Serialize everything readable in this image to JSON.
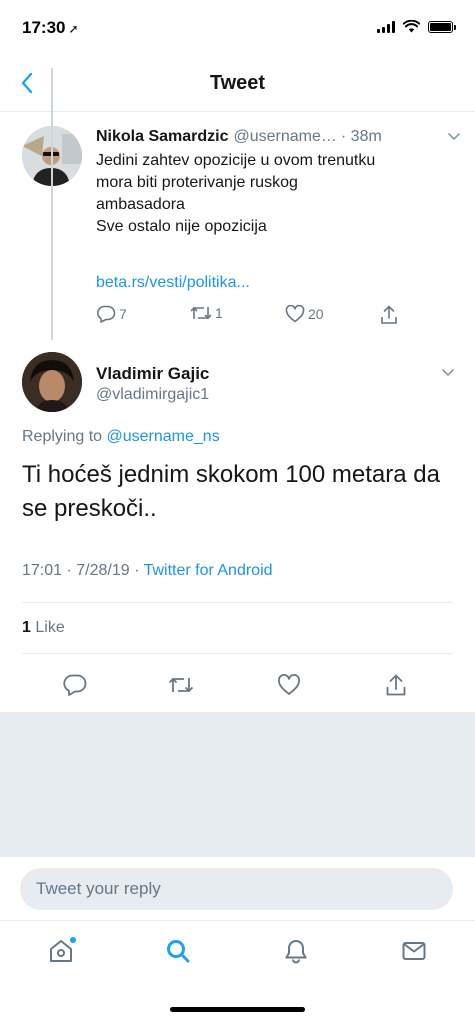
{
  "status_bar": {
    "time": "17:30",
    "location_arrow": "➚"
  },
  "header": {
    "title": "Tweet"
  },
  "parent_tweet": {
    "name": "Nikola Samardzic",
    "handle": "@username…",
    "time": "· 38m",
    "text_lines": [
      "Jedini zahtev opozicije u ovom trenutku",
      "mora biti proterivanje ruskog",
      "ambasadora",
      "Sve ostalo nije opozicija"
    ],
    "link": "beta.rs/vesti/politika...",
    "reply_count": "7",
    "retweet_count": "1",
    "like_count": "20"
  },
  "reply_tweet": {
    "name": "Vladimir Gajic",
    "handle": "@vladimirgajic1",
    "replying_prefix": "Replying to",
    "replying_to": "@username_ns",
    "text": "Ti hoćeš jednim skokom 100 metara da se preskoči..",
    "meta_datetime": "17:01 · 7/28/19 ·",
    "meta_source": "Twitter for Android",
    "like_count": "1",
    "like_label": "Like"
  },
  "composer": {
    "placeholder": "Tweet your reply"
  },
  "colors": {
    "accent": "#1da1f2",
    "link": "#1b95e0",
    "secondary_text": "#657786",
    "divider": "#e6ecf0"
  },
  "tabs": [
    "home-icon",
    "search-icon",
    "notifications-icon",
    "messages-icon"
  ]
}
